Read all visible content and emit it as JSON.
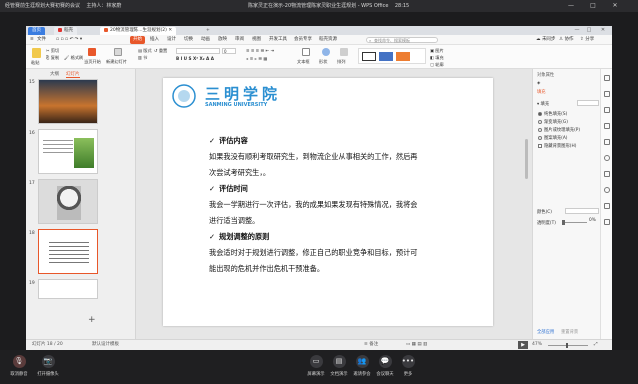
{
  "meeting": {
    "title": "经管赛前生涯规划大赛初赛的会议",
    "host_label": "主持人：",
    "host_name": "林家蔚",
    "share_title": "陈家灵正在演示-20物流管理陈家灵职业生涯规划 - WPS Office",
    "timer": "28:15",
    "bottom": {
      "mic": "取消静音",
      "camera": "打开摄像头",
      "screen_share": "屏幕演示",
      "doc": "文档演示",
      "members": "邀请参会",
      "chat": "会议聊天",
      "more": "更多"
    }
  },
  "wps": {
    "tabs": {
      "home": "首页",
      "templates": "稻壳",
      "doc": "20物流管理陈...生涯规划(2)"
    },
    "menu": [
      "文件",
      "开始",
      "插入",
      "设计",
      "切换",
      "动画",
      "放映",
      "审阅",
      "视图",
      "开发工具",
      "会员专享",
      "稻壳资源"
    ],
    "active_menu": "开始",
    "search_placeholder": "查找命令、搜索模板",
    "account": {
      "sync": "未同步",
      "collab": "协作",
      "share": "分享"
    },
    "ribbon": {
      "paste": "粘贴",
      "cut": "剪切",
      "copy": "复制",
      "format_painter": "格式刷",
      "current_start": "当页开始",
      "new_slide": "新建幻灯片",
      "layout": "版式",
      "section": "节",
      "reset": "重置",
      "font_size": "0",
      "textbox": "文本框",
      "shape": "形状",
      "arrange": "排列",
      "picture": "图片",
      "fill": "填充",
      "outline": "轮廓"
    }
  },
  "thumbnails": {
    "tabs": {
      "outline": "大纲",
      "slides": "幻灯片"
    },
    "items": [
      {
        "num": "15"
      },
      {
        "num": "16"
      },
      {
        "num": "17"
      },
      {
        "num": "18"
      },
      {
        "num": "19"
      }
    ],
    "add_symbol": "+"
  },
  "slide": {
    "logo_cn": "三明学院",
    "logo_en": "SANMING UNIVERSITY",
    "sections": [
      {
        "heading": "评估内容",
        "lines": [
          "如果我没有顺利考取研究生，到物流企业从事相关的工作，然后再",
          "次尝试考研究生，。"
        ]
      },
      {
        "heading": "评估时间",
        "lines": [
          "我会一学期进行一次评估，我的成果如果发现有特殊情况，我将会",
          "进行适当调整。"
        ]
      },
      {
        "heading": "规划调整的原则",
        "lines": [
          "我会适时对于规划进行调整，修正自己的职业竞争和目标，预计可",
          "能出现的危机并作出危机干预准备。"
        ]
      }
    ],
    "check_glyph": "✓"
  },
  "props": {
    "title": "对象属性",
    "tab": "填充",
    "section": "填充",
    "options": [
      "纯色填充(S)",
      "渐变填充(G)",
      "图片或纹理填充(P)",
      "图案填充(A)",
      "隐藏背景图形(H)"
    ],
    "color_label": "颜色(C)",
    "transparency_label": "透明度(T)",
    "transparency_value": "0%",
    "apply_all": "全部应用",
    "reset_bg": "重置背景"
  },
  "status": {
    "slide_pos": "幻灯片 18 / 20",
    "theme": "默认设计模板",
    "notes": "备注",
    "zoom": "47%"
  },
  "colors": {
    "accent": "#e8572a",
    "logo_blue": "#2b8fd1"
  }
}
